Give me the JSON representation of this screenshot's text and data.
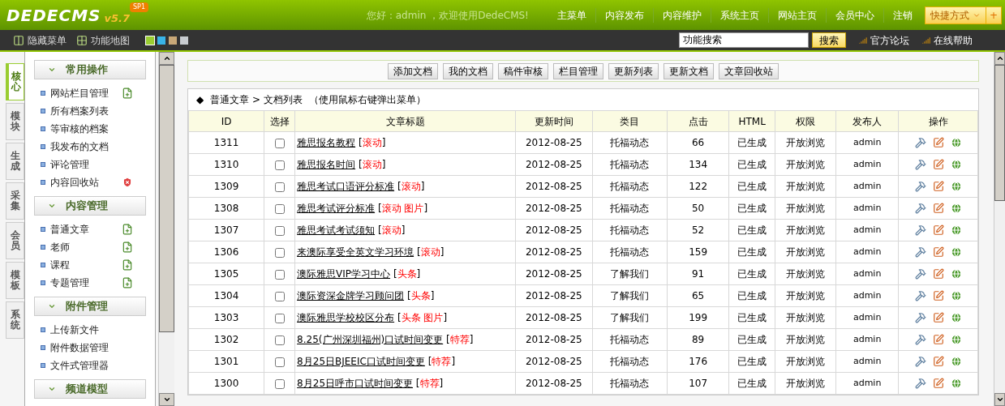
{
  "header": {
    "logo": "DEDECMS",
    "version": "v5.7",
    "edition": "SP1",
    "greeting": "您好：admin ，欢迎使用DedeCMS!",
    "nav": [
      "主菜单",
      "内容发布",
      "内容维护",
      "系统主页",
      "网站主页",
      "会员中心",
      "注销"
    ],
    "shortcut": {
      "label": "快捷方式",
      "add": "+"
    }
  },
  "toolbar": {
    "links": [
      {
        "label": "隐藏菜单",
        "kind": "hide"
      },
      {
        "label": "功能地图",
        "kind": "map"
      }
    ],
    "skins": [
      {
        "color": "#9acd32",
        "selected": true
      },
      {
        "color": "#39b4e8",
        "selected": false
      },
      {
        "color": "#c8a878",
        "selected": false
      },
      {
        "color": "#c8ccd0",
        "selected": false
      }
    ],
    "search": {
      "value": "功能搜索",
      "button": "搜索"
    },
    "help_links": [
      "官方论坛",
      "在线帮助"
    ]
  },
  "side_tabs": [
    {
      "label": "核心",
      "selected": true
    },
    {
      "label": "模块",
      "selected": false
    },
    {
      "label": "生成",
      "selected": false
    },
    {
      "label": "采集",
      "selected": false
    },
    {
      "label": "会员",
      "selected": false
    },
    {
      "label": "模板",
      "selected": false
    },
    {
      "label": "系统",
      "selected": false
    }
  ],
  "sidebar": [
    {
      "title": "常用操作",
      "items": [
        {
          "label": "网站栏目管理",
          "kind": "add"
        },
        {
          "label": "所有档案列表"
        },
        {
          "label": "等审核的档案"
        },
        {
          "label": "我发布的文档"
        },
        {
          "label": "评论管理"
        },
        {
          "label": "内容回收站",
          "kind": "delete"
        }
      ]
    },
    {
      "title": "内容管理",
      "items": [
        {
          "label": "普通文章",
          "kind": "add"
        },
        {
          "label": "老师",
          "kind": "add"
        },
        {
          "label": "课程",
          "kind": "add"
        },
        {
          "label": "专题管理",
          "kind": "add"
        }
      ]
    },
    {
      "title": "附件管理",
      "items": [
        {
          "label": "上传新文件"
        },
        {
          "label": "附件数据管理"
        },
        {
          "label": "文件式管理器"
        }
      ]
    },
    {
      "title": "频道模型"
    }
  ],
  "actions": [
    "添加文档",
    "我的文档",
    "稿件审核",
    "栏目管理",
    "更新列表",
    "更新文档",
    "文章回收站"
  ],
  "breadcrumb": {
    "marker": "◆",
    "path": "普通文章 > 文档列表",
    "hint": "（使用鼠标右键弹出菜单）"
  },
  "table": {
    "columns": [
      "ID",
      "选择",
      "文章标题",
      "更新时间",
      "类目",
      "点击",
      "HTML",
      "权限",
      "发布人",
      "操作"
    ],
    "rows": [
      {
        "id": "1311",
        "checked": false,
        "title": "雅思报名教程",
        "tags": "[滚动]",
        "date": "2012-08-25",
        "category": "托福动态",
        "clicks": "66",
        "html": "已生成",
        "access": "开放浏览",
        "author": "admin"
      },
      {
        "id": "1310",
        "checked": false,
        "title": "雅思报名时间",
        "tags": "[滚动]",
        "date": "2012-08-25",
        "category": "托福动态",
        "clicks": "134",
        "html": "已生成",
        "access": "开放浏览",
        "author": "admin"
      },
      {
        "id": "1309",
        "checked": false,
        "title": "雅思考试口语评分标准",
        "tags": "[滚动]",
        "date": "2012-08-25",
        "category": "托福动态",
        "clicks": "122",
        "html": "已生成",
        "access": "开放浏览",
        "author": "admin"
      },
      {
        "id": "1308",
        "checked": false,
        "title": "雅思考试评分标准",
        "tags": "[滚动 图片]",
        "date": "2012-08-25",
        "category": "托福动态",
        "clicks": "50",
        "html": "已生成",
        "access": "开放浏览",
        "author": "admin"
      },
      {
        "id": "1307",
        "checked": false,
        "title": "雅思考试考试须知",
        "tags": "[滚动]",
        "date": "2012-08-25",
        "category": "托福动态",
        "clicks": "52",
        "html": "已生成",
        "access": "开放浏览",
        "author": "admin"
      },
      {
        "id": "1306",
        "checked": false,
        "title": "来澳际享受全英文学习环境",
        "tags": "[滚动]",
        "date": "2012-08-25",
        "category": "托福动态",
        "clicks": "159",
        "html": "已生成",
        "access": "开放浏览",
        "author": "admin"
      },
      {
        "id": "1305",
        "checked": false,
        "title": "澳际雅思VIP学习中心",
        "tags": "[头条]",
        "date": "2012-08-25",
        "category": "了解我们",
        "clicks": "91",
        "html": "已生成",
        "access": "开放浏览",
        "author": "admin"
      },
      {
        "id": "1304",
        "checked": false,
        "title": "澳际资深金牌学习顾问团",
        "tags": "[头条]",
        "date": "2012-08-25",
        "category": "了解我们",
        "clicks": "65",
        "html": "已生成",
        "access": "开放浏览",
        "author": "admin"
      },
      {
        "id": "1303",
        "checked": false,
        "title": "澳际雅思学校校区分布",
        "tags": "[头条 图片]",
        "date": "2012-08-25",
        "category": "了解我们",
        "clicks": "199",
        "html": "已生成",
        "access": "开放浏览",
        "author": "admin"
      },
      {
        "id": "1302",
        "checked": false,
        "title": "8.25(广州深圳福州)口试时间变更",
        "tags": "[特荐]",
        "date": "2012-08-25",
        "category": "托福动态",
        "clicks": "89",
        "html": "已生成",
        "access": "开放浏览",
        "author": "admin"
      },
      {
        "id": "1301",
        "checked": false,
        "title": "8月25日BJEEIC口试时间变更",
        "tags": "[特荐]",
        "date": "2012-08-25",
        "category": "托福动态",
        "clicks": "176",
        "html": "已生成",
        "access": "开放浏览",
        "author": "admin"
      },
      {
        "id": "1300",
        "checked": false,
        "title": "8月25日呼市口试时间变更",
        "tags": "[特荐]",
        "date": "2012-08-25",
        "category": "托福动态",
        "clicks": "107",
        "html": "已生成",
        "access": "开放浏览",
        "author": "admin"
      }
    ]
  }
}
